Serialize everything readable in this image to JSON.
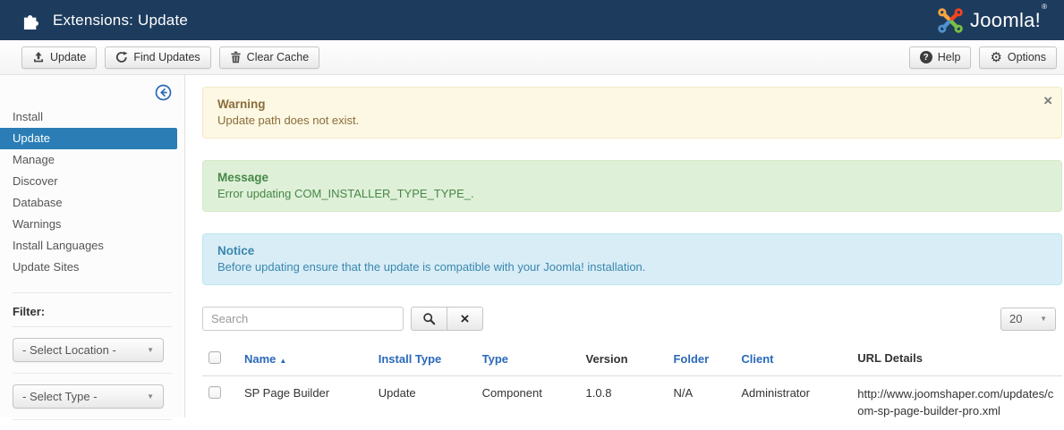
{
  "header": {
    "title": "Extensions: Update",
    "logo_text": "Joomla!",
    "logo_reg": "®"
  },
  "toolbar": {
    "update_label": "Update",
    "find_updates_label": "Find Updates",
    "clear_cache_label": "Clear Cache",
    "help_label": "Help",
    "options_label": "Options"
  },
  "sidebar": {
    "items": [
      {
        "label": "Install",
        "active": false
      },
      {
        "label": "Update",
        "active": true
      },
      {
        "label": "Manage",
        "active": false
      },
      {
        "label": "Discover",
        "active": false
      },
      {
        "label": "Database",
        "active": false
      },
      {
        "label": "Warnings",
        "active": false
      },
      {
        "label": "Install Languages",
        "active": false
      },
      {
        "label": "Update Sites",
        "active": false
      }
    ],
    "filter_label": "Filter:",
    "location_select_value": "- Select Location -",
    "type_select_value": "- Select Type -"
  },
  "alerts": [
    {
      "type": "warning",
      "title": "Warning",
      "text": "Update path does not exist.",
      "closable": true
    },
    {
      "type": "success",
      "title": "Message",
      "text": "Error updating COM_INSTALLER_TYPE_TYPE_.",
      "closable": false
    },
    {
      "type": "info",
      "title": "Notice",
      "text": "Before updating ensure that the update is compatible with your Joomla! installation.",
      "closable": false
    }
  ],
  "search": {
    "placeholder": "Search",
    "value": ""
  },
  "list_limit": "20",
  "table": {
    "columns": [
      {
        "label": "Name",
        "sortable": true,
        "sorted": "asc"
      },
      {
        "label": "Install Type",
        "sortable": true
      },
      {
        "label": "Type",
        "sortable": true
      },
      {
        "label": "Version",
        "sortable": false
      },
      {
        "label": "Folder",
        "sortable": true
      },
      {
        "label": "Client",
        "sortable": true
      },
      {
        "label": "URL Details",
        "sortable": false
      }
    ],
    "rows": [
      {
        "name": "SP Page Builder",
        "install_type": "Update",
        "type": "Component",
        "version": "1.0.8",
        "folder": "N/A",
        "client": "Administrator",
        "url": "http://www.joomshaper.com/updates/com-sp-page-builder-pro.xml"
      }
    ]
  },
  "colors": {
    "header_bg": "#1d3c5d",
    "link_blue": "#2a69b8",
    "active_item_bg": "#2a7db5",
    "warning_bg": "#fcf8e3",
    "warning_text": "#8a6d3b",
    "success_bg": "#dff0d8",
    "success_text": "#468847",
    "info_bg": "#d9edf7",
    "info_text": "#3a87ad",
    "joomla_orange": "#f9a541",
    "joomla_blue": "#5091cd",
    "joomla_green": "#7ac143",
    "joomla_red": "#f44321"
  }
}
